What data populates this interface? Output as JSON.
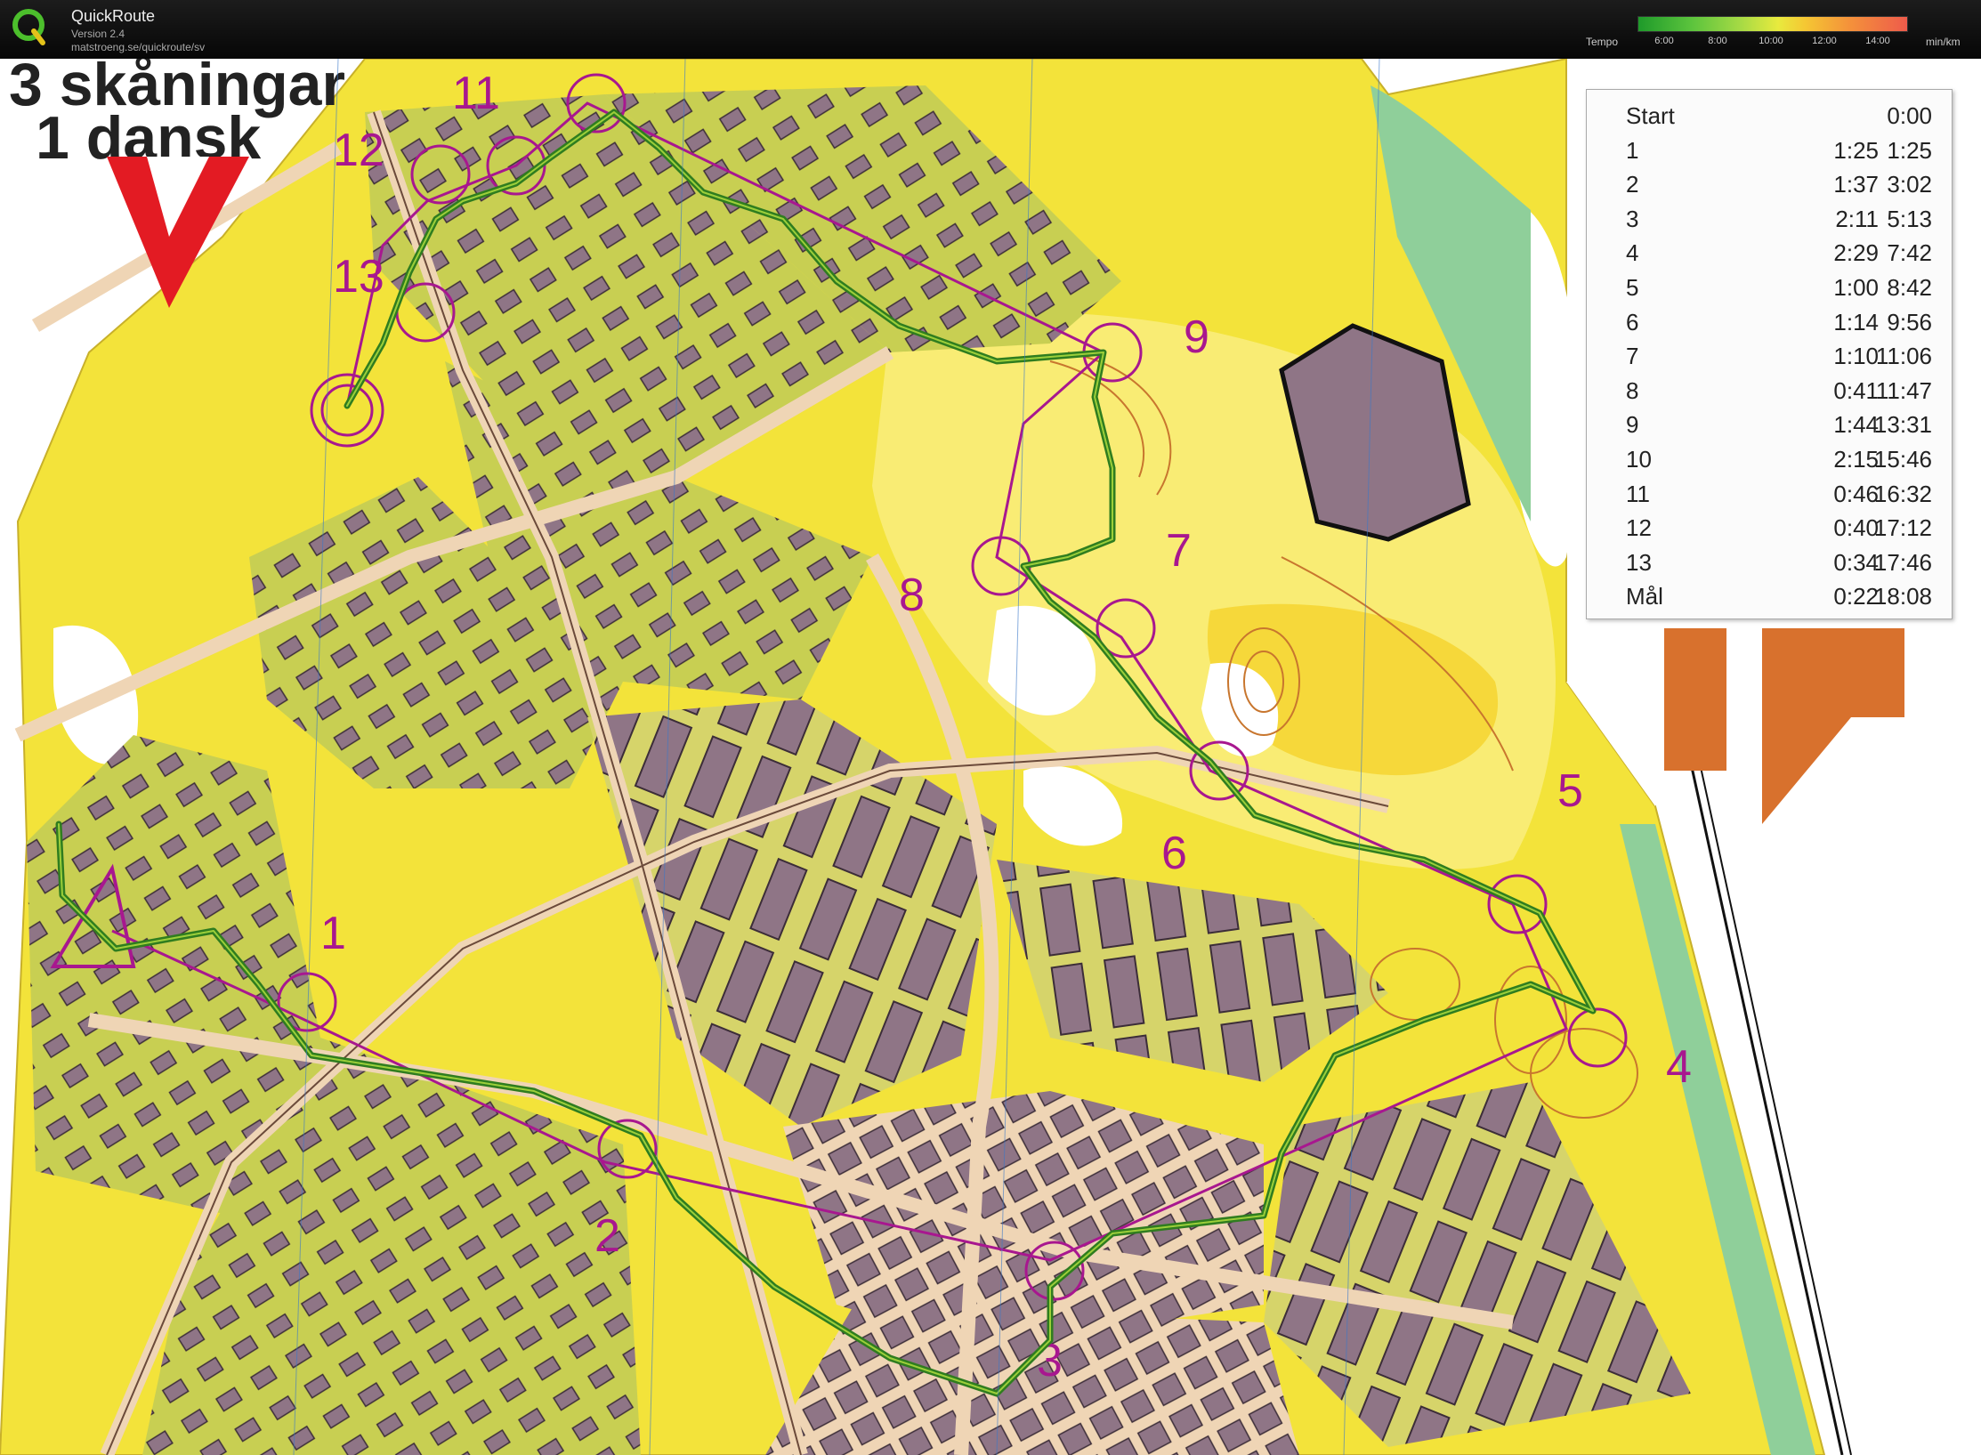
{
  "app": {
    "name": "QuickRoute",
    "version": "Version 2.4",
    "url": "matstroeng.se/quickroute/sv"
  },
  "tempo_legend": {
    "label": "Tempo",
    "ticks": [
      "6:00",
      "8:00",
      "10:00",
      "12:00",
      "14:00"
    ],
    "unit": "min/km"
  },
  "map_title": {
    "line1": "3 skåningar",
    "line2": "1 dansk"
  },
  "controls": [
    {
      "label": "1"
    },
    {
      "label": "2"
    },
    {
      "label": "3"
    },
    {
      "label": "4"
    },
    {
      "label": "5"
    },
    {
      "label": "6"
    },
    {
      "label": "7"
    },
    {
      "label": "8"
    },
    {
      "label": "9"
    },
    {
      "label": "11"
    },
    {
      "label": "12"
    },
    {
      "label": "13"
    }
  ],
  "splits": [
    {
      "name": "Start",
      "leg": "",
      "total": "0:00"
    },
    {
      "name": "1",
      "leg": "1:25",
      "total": "1:25"
    },
    {
      "name": "2",
      "leg": "1:37",
      "total": "3:02"
    },
    {
      "name": "3",
      "leg": "2:11",
      "total": "5:13"
    },
    {
      "name": "4",
      "leg": "2:29",
      "total": "7:42"
    },
    {
      "name": "5",
      "leg": "1:00",
      "total": "8:42"
    },
    {
      "name": "6",
      "leg": "1:14",
      "total": "9:56"
    },
    {
      "name": "7",
      "leg": "1:10",
      "total": "11:06"
    },
    {
      "name": "8",
      "leg": "0:41",
      "total": "11:47"
    },
    {
      "name": "9",
      "leg": "1:44",
      "total": "13:31"
    },
    {
      "name": "10",
      "leg": "2:15",
      "total": "15:46"
    },
    {
      "name": "11",
      "leg": "0:46",
      "total": "16:32"
    },
    {
      "name": "12",
      "leg": "0:40",
      "total": "17:12"
    },
    {
      "name": "13",
      "leg": "0:34",
      "total": "17:46"
    },
    {
      "name": "Mål",
      "leg": "0:22",
      "total": "18:08"
    }
  ],
  "colors": {
    "course": "#a8178f",
    "route": "#2f7d1f",
    "open_land": "#f3e33a",
    "vegetation": "#c7cf4e",
    "buildings": "#8f7586",
    "paved": "#efd5b5"
  }
}
